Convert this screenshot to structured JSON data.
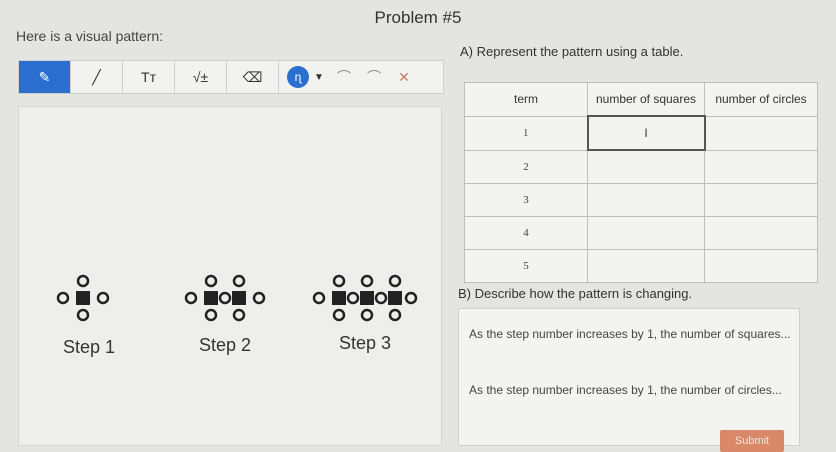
{
  "header": {
    "problem_title": "Problem #5",
    "prompt": "Here is a visual pattern:",
    "part_a": "A) Represent the pattern using a table.",
    "part_b": "B) Describe how the pattern is changing."
  },
  "toolbar": {
    "tools": [
      {
        "name": "pen",
        "label": "✎"
      },
      {
        "name": "line",
        "label": "╱"
      },
      {
        "name": "text",
        "label": "Tт"
      },
      {
        "name": "math",
        "label": "√±"
      },
      {
        "name": "eraser",
        "label": "⌫"
      }
    ],
    "color_label": "ɳ",
    "dropdown": "▼",
    "undo": "⌒",
    "redo": "⌒",
    "clear": "✕"
  },
  "steps": [
    {
      "label": "Step 1",
      "squares": 1
    },
    {
      "label": "Step 2",
      "squares": 2
    },
    {
      "label": "Step 3",
      "squares": 3
    }
  ],
  "table": {
    "headers": [
      "term",
      "number of squares",
      "number of circles"
    ],
    "rows": [
      {
        "term": "1",
        "squares": "I",
        "circles": ""
      },
      {
        "term": "2",
        "squares": "",
        "circles": ""
      },
      {
        "term": "3",
        "squares": "",
        "circles": ""
      },
      {
        "term": "4",
        "squares": "",
        "circles": ""
      },
      {
        "term": "5",
        "squares": "",
        "circles": ""
      }
    ]
  },
  "answers": {
    "squares": "As the step number increases by 1, the number of squares...",
    "circles": "As the step number increases by 1, the number of circles..."
  },
  "submit": "Submit",
  "colors": {
    "accent": "#2a6fd0",
    "submit": "#d9896a"
  }
}
